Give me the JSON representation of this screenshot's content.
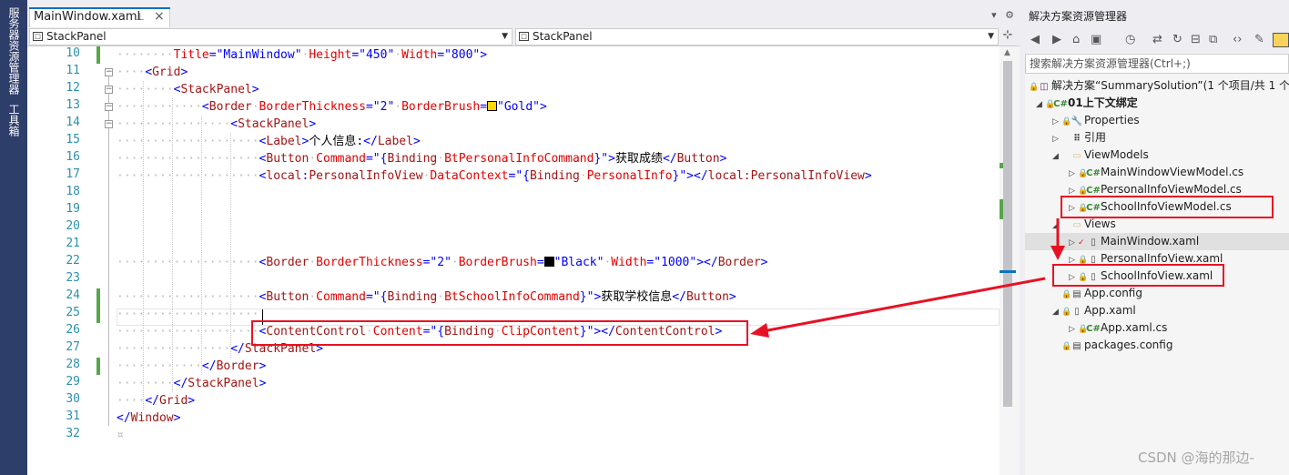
{
  "left_toolbar": {
    "tab1": "服务器资源管理器",
    "tab2": "工具箱"
  },
  "editor": {
    "tab": {
      "title": "MainWindow.xaml",
      "pin_icon": "pin-icon",
      "close_icon": "close-icon"
    },
    "nav_left": "StackPanel",
    "nav_right": "StackPanel",
    "line_numbers": [
      "10",
      "11",
      "12",
      "13",
      "14",
      "15",
      "16",
      "17",
      "18",
      "19",
      "20",
      "21",
      "22",
      "23",
      "24",
      "25",
      "26",
      "27",
      "28",
      "29",
      "30",
      "31",
      "32"
    ],
    "lines": {
      "l10": {
        "attr": "Title",
        "val": "MainWindow",
        "attr2": "Height",
        "val2": "450",
        "attr3": "Width",
        "val3": "800"
      },
      "l11": {
        "el": "Grid"
      },
      "l12": {
        "el": "StackPanel"
      },
      "l13": {
        "el": "Border",
        "attr": "BorderThickness",
        "val": "2",
        "attr2": "BorderBrush",
        "val2": "Gold",
        "swatch": "#ffd700"
      },
      "l14": {
        "el": "StackPanel"
      },
      "l15": {
        "el": "Label",
        "text": "个人信息:",
        "close": "Label"
      },
      "l16": {
        "el": "Button",
        "attr": "Command",
        "bind": "Binding",
        "path": "BtPersonalInfoCommand",
        "text": "获取成绩",
        "close": "Button"
      },
      "l17": {
        "ns": "local",
        "el": "PersonalInfoView",
        "attr": "DataContext",
        "bind": "Binding",
        "path": "PersonalInfo",
        "close": "local:PersonalInfoView"
      },
      "l21": {
        "el": "Border",
        "attr": "BorderThickness",
        "val": "2",
        "attr2": "BorderBrush",
        "val2": "Black",
        "swatch": "#000000",
        "attr3": "Width",
        "val3": "1000",
        "close": "Border"
      },
      "l24": {
        "el": "Button",
        "attr": "Command",
        "bind": "Binding",
        "path": "BtSchoolInfoCommand",
        "text": "获取学校信息",
        "close": "Button"
      },
      "l26": {
        "el": "ContentControl",
        "attr": "Content",
        "bind": "Binding",
        "path": "ClipContent",
        "close": "ContentControl"
      },
      "l27": {
        "close": "StackPanel"
      },
      "l28": {
        "close": "Border"
      },
      "l29": {
        "close": "StackPanel"
      },
      "l30": {
        "close": "Grid"
      },
      "l31": {
        "close": "Window"
      }
    }
  },
  "solution_explorer": {
    "title": "解决方案资源管理器",
    "search_placeholder": "搜索解决方案资源管理器(Ctrl+;)",
    "items": [
      {
        "label": "解决方案“SummarySolution”(1 个项目/共 1 个)",
        "icon": "solution-icon"
      },
      {
        "label": "01上下文绑定",
        "icon": "csharp-project-icon"
      },
      {
        "label": "Properties",
        "icon": "wrench-icon"
      },
      {
        "label": "引用",
        "icon": "references-icon"
      },
      {
        "label": "ViewModels",
        "icon": "folder-icon"
      },
      {
        "label": "MainWindowViewModel.cs",
        "icon": "csharp-file-icon"
      },
      {
        "label": "PersonalInfoViewModel.cs",
        "icon": "csharp-file-icon"
      },
      {
        "label": "SchoolInfoViewModel.cs",
        "icon": "csharp-file-icon"
      },
      {
        "label": "Views",
        "icon": "folder-icon"
      },
      {
        "label": "MainWindow.xaml",
        "icon": "xaml-file-icon"
      },
      {
        "label": "PersonalInfoView.xaml",
        "icon": "xaml-file-icon"
      },
      {
        "label": "SchoolInfoView.xaml",
        "icon": "xaml-file-icon"
      },
      {
        "label": "App.config",
        "icon": "config-file-icon"
      },
      {
        "label": "App.xaml",
        "icon": "xaml-file-icon"
      },
      {
        "label": "App.xaml.cs",
        "icon": "csharp-file-icon"
      },
      {
        "label": "packages.config",
        "icon": "config-file-icon"
      }
    ]
  },
  "watermark": "CSDN @海的那边-",
  "colors": {
    "accent": "#0e70c0",
    "annotation": "#e81123",
    "toolwindow": "#2d3e6b"
  }
}
